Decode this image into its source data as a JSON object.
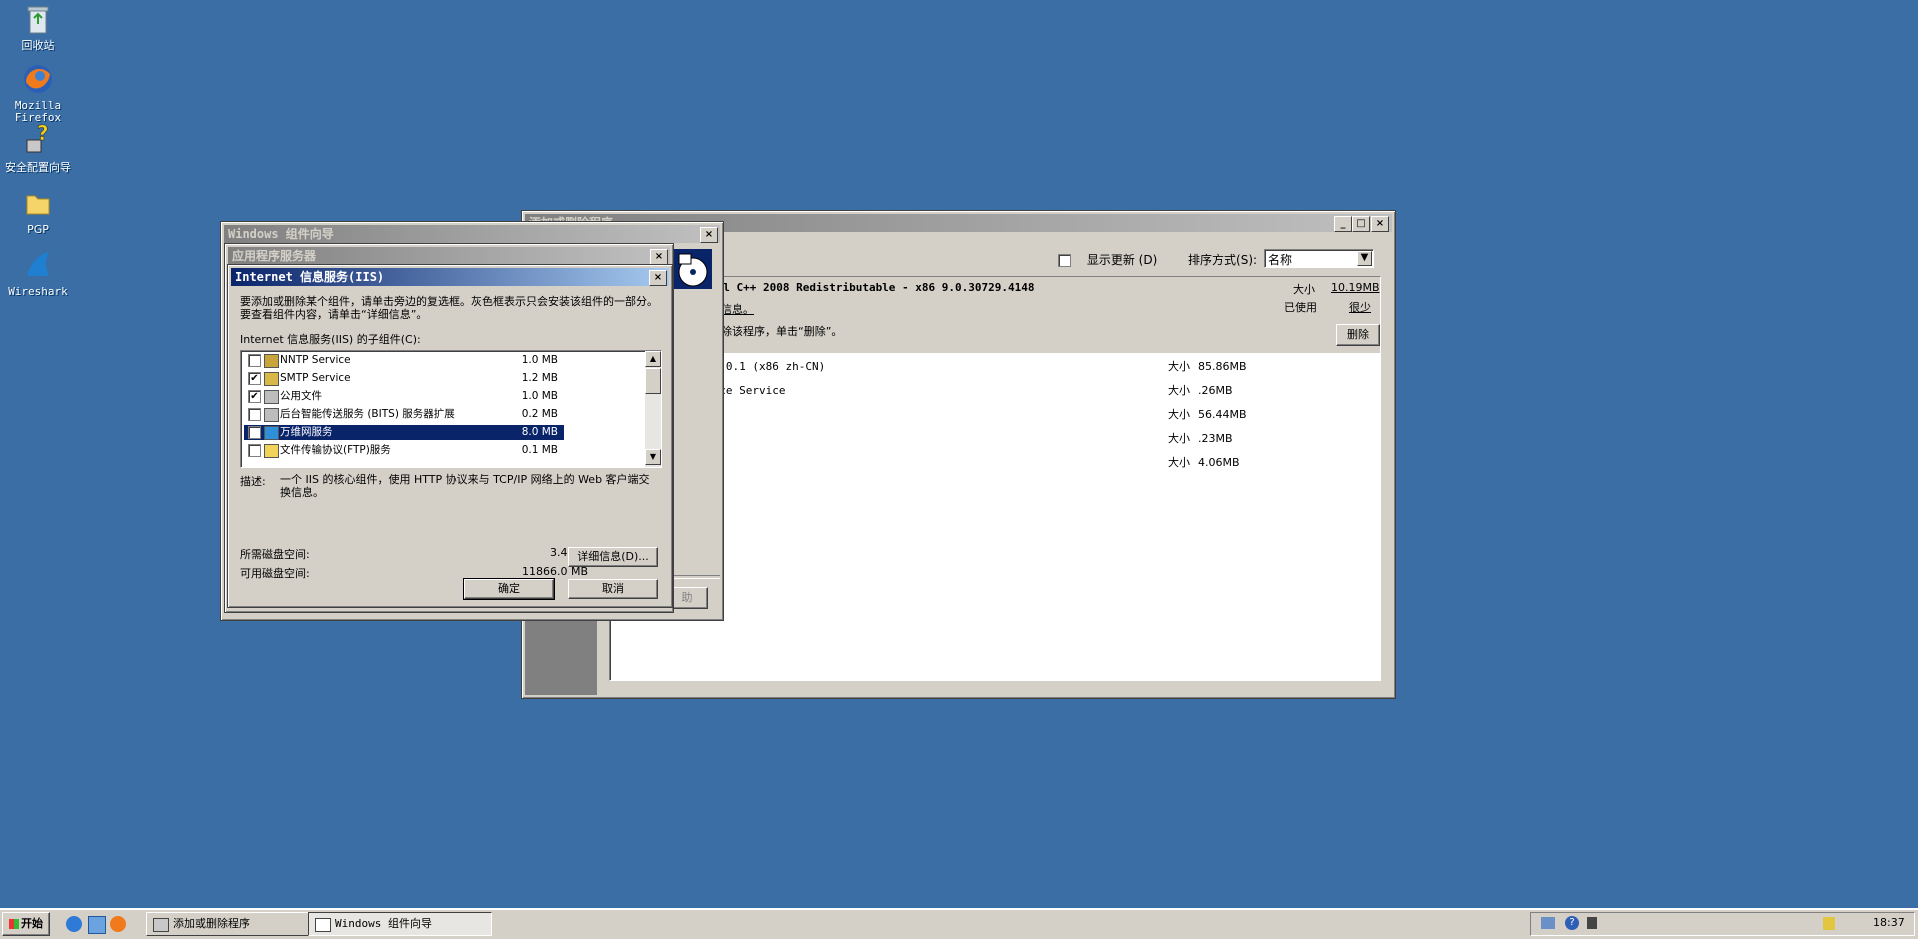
{
  "desktop": {
    "icons": [
      {
        "label": "回收站",
        "icon": "recycle-bin-icon"
      },
      {
        "label": "Mozilla Firefox",
        "icon": "firefox-icon"
      },
      {
        "label": "安全配置向导",
        "icon": "security-wizard-icon"
      },
      {
        "label": "PGP",
        "icon": "folder-icon"
      },
      {
        "label": "Wireshark",
        "icon": "wireshark-icon"
      }
    ]
  },
  "addremove": {
    "title": "添加或删除程序",
    "show_updates_label": "显示更新",
    "show_updates_key": "(D)",
    "sort_label": "排序方式",
    "sort_key": "(S):",
    "sort_value": "名称",
    "selected": {
      "name": "ual C++ 2008 Redistributable - x86 9.0.30729.4148",
      "support_link": "持信息。",
      "remove_text": "删除该程序，单击“删除”。",
      "size_label": "大小",
      "size_value": "10.19MB",
      "used_label": "已使用",
      "used_value": "很少",
      "remove_button": "删除"
    },
    "programs": [
      {
        "name": "41.0.1 (x86 zh-CN)",
        "size_label": "大小",
        "size": "85.86MB"
      },
      {
        "name": "ance Service",
        "size_label": "大小",
        "size": ".26MB"
      },
      {
        "name": "",
        "size_label": "大小",
        "size": "56.44MB"
      },
      {
        "name": "",
        "size_label": "大小",
        "size": ".23MB"
      },
      {
        "name": "",
        "size_label": "大小",
        "size": "4.06MB"
      }
    ]
  },
  "wizard": {
    "title": "Windows 组件向导",
    "hidden_button": "助"
  },
  "appserver": {
    "title": "应用程序服务器"
  },
  "iis": {
    "title": "Internet 信息服务(IIS)",
    "instruction": "要添加或删除某个组件，请单击旁边的复选框。灰色框表示只会安装该组件的一部分。要查看组件内容，请单击“详细信息”。",
    "subcomponents_label": "Internet 信息服务(IIS) 的子组件(C):",
    "components": [
      {
        "checked": false,
        "name": "NNTP Service",
        "size": "1.0 MB",
        "icon": "news-icon",
        "selected": false
      },
      {
        "checked": true,
        "name": "SMTP Service",
        "size": "1.2 MB",
        "icon": "mail-icon",
        "selected": false
      },
      {
        "checked": true,
        "name": "公用文件",
        "size": "1.0 MB",
        "icon": "component-icon",
        "selected": false
      },
      {
        "checked": false,
        "name": "后台智能传送服务 (BITS) 服务器扩展",
        "size": "0.2 MB",
        "icon": "component-icon",
        "selected": false
      },
      {
        "checked": true,
        "name": "万维网服务",
        "size": "8.0 MB",
        "icon": "globe-icon",
        "selected": true
      },
      {
        "checked": false,
        "name": "文件传输协议(FTP)服务",
        "size": "0.1 MB",
        "icon": "ftp-folder-icon",
        "selected": false
      }
    ],
    "description_label": "描述:",
    "description": "一个 IIS 的核心组件，使用 HTTP 协议来与 TCP/IP 网络上的 Web 客户端交换信息。",
    "disk_required_label": "所需磁盘空间:",
    "disk_required": "3.4 MB",
    "disk_available_label": "可用磁盘空间:",
    "disk_available": "11866.0 MB",
    "details_button": "详细信息(D)...",
    "ok_button": "确定",
    "cancel_button": "取消"
  },
  "taskbar": {
    "start_label": "开始",
    "tasks": [
      {
        "label": "添加或删除程序",
        "active": false
      },
      {
        "label": "Windows 组件向导",
        "active": true
      }
    ],
    "clock": "18:37"
  }
}
